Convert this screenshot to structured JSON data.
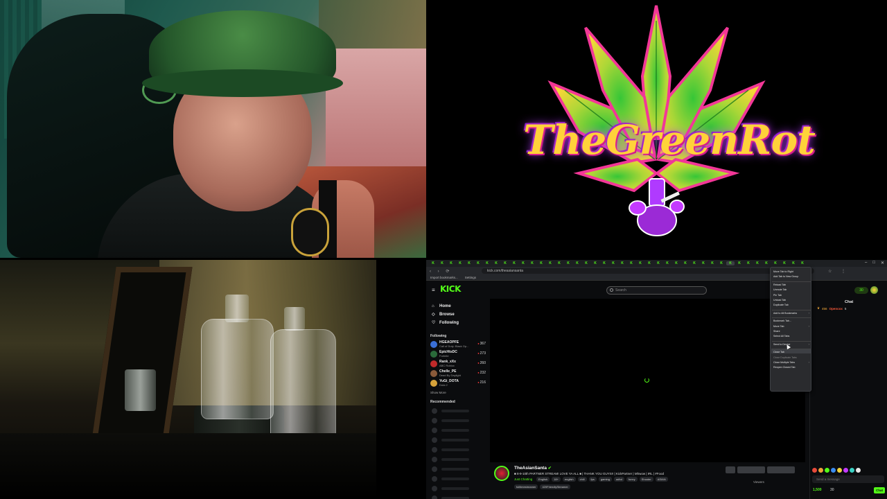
{
  "logo": {
    "text": "TheGreenRot",
    "colors": {
      "leaf_green": "#3ad13a",
      "leaf_yellow": "#ffe23a",
      "neon_pink": "#ff3aa0",
      "neon_purple": "#9b3aff"
    }
  },
  "browser": {
    "url": "kick.com/theasiansanta",
    "bookmarks": [
      "Import bookmarks...",
      "Settings"
    ]
  },
  "kick": {
    "logo_text": "KICK",
    "search_placeholder": "Search",
    "coins": "30",
    "nav": [
      "Home",
      "Browse",
      "Following"
    ],
    "following_label": "Following",
    "following": [
      {
        "name": "HGEAOPFE",
        "game": "Call of Duty: Black Op...",
        "viewers": "367",
        "color": "#3a6fd6"
      },
      {
        "name": "EpicHtsDC",
        "game": "Fortnite",
        "viewers": "273",
        "color": "#2a6a3a"
      },
      {
        "name": "Rank_xXx",
        "game": "ABC Roblox",
        "viewers": "260",
        "color": "#c02a2a"
      },
      {
        "name": "Chelle_PE",
        "game": "Dead By Daylight",
        "viewers": "232",
        "color": "#8a5a3a"
      },
      {
        "name": "YuGi_DOTA",
        "game": "Dota 2",
        "viewers": "216",
        "color": "#d6a23a"
      }
    ],
    "show_more": "Show More",
    "recommended_label": "Recommended",
    "stream": {
      "streamer": "TheAsianSanta",
      "title": "■ 8-9-10th PARTNER STREAM! LOVE YA ALL ■ | THANK YOU GUYS!! | KickPartner | Mhwow | IRL | #Food",
      "category": "Just Chatting",
      "tags": [
        "English",
        "18+",
        "english",
        "chill",
        "fps",
        "gaming",
        "adhd",
        "funny",
        "Shooter",
        "ASIAN"
      ],
      "tags2": [
        "fulltimestreamer",
        "420FriendlyStreamer"
      ],
      "viewers_label": "Viewers"
    },
    "chat": {
      "title": "Chat",
      "pinned_amount": "456",
      "pinned_user": "Opencox",
      "pinned_count": "5",
      "input_placeholder": "Send a message",
      "points": "1,500",
      "bag": "30",
      "send_label": "Chat"
    }
  },
  "context_menu": {
    "items": [
      {
        "label": "Move Tab to Right",
        "dim": false,
        "arrow": false
      },
      {
        "label": "Add Tab to New Group",
        "dim": false,
        "arrow": false
      },
      {
        "sep": true
      },
      {
        "label": "Reload Tab",
        "dim": false,
        "arrow": false
      },
      {
        "label": "Unmute Tab",
        "dim": false,
        "arrow": false
      },
      {
        "label": "Pin Tab",
        "dim": false,
        "arrow": false
      },
      {
        "label": "Unload Tab",
        "dim": false,
        "arrow": false
      },
      {
        "label": "Duplicate Tab",
        "dim": false,
        "arrow": false
      },
      {
        "sep": true
      },
      {
        "label": "Add to All Bookmarks",
        "dim": false,
        "arrow": true
      },
      {
        "sep": true
      },
      {
        "label": "Bookmark Tab...",
        "dim": false,
        "arrow": false
      },
      {
        "label": "Move Tab",
        "dim": false,
        "arrow": true
      },
      {
        "label": "Share",
        "dim": false,
        "arrow": false
      },
      {
        "label": "Select All Tabs",
        "dim": false,
        "arrow": false
      },
      {
        "sep": true
      },
      {
        "label": "Send to Device",
        "dim": false,
        "arrow": true
      },
      {
        "sep": true
      },
      {
        "label": "Close Tab",
        "dim": false,
        "arrow": false
      },
      {
        "label": "Close Duplicate Tabs",
        "dim": true,
        "arrow": false
      },
      {
        "label": "Close Multiple Tabs",
        "dim": false,
        "arrow": true
      },
      {
        "label": "Reopen Closed Tab",
        "dim": false,
        "arrow": false
      }
    ]
  }
}
